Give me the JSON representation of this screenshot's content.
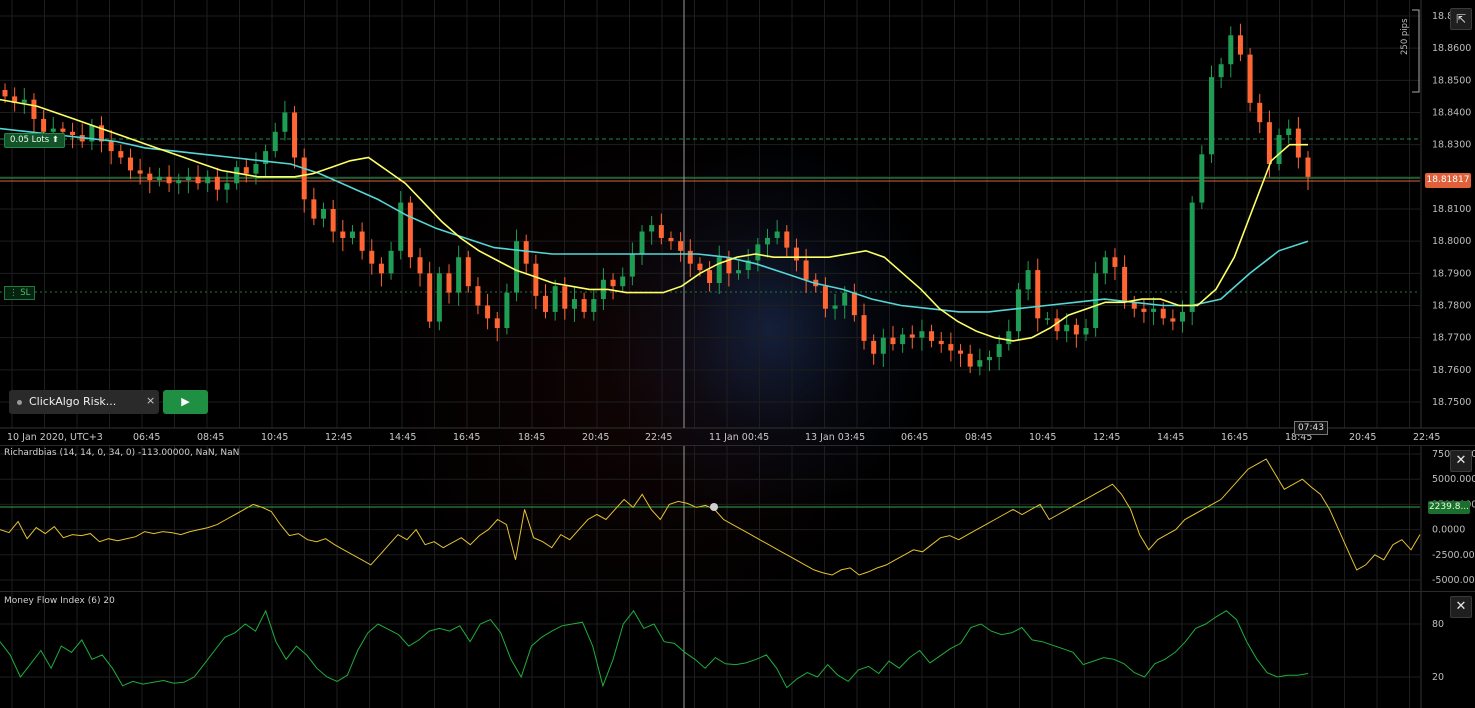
{
  "symbol_lot_label": "0.05 Lots ⬆",
  "sl_label": "⋮ SL",
  "bot": {
    "name": "ClickAlgo Risk...",
    "close": "×",
    "play": "▶"
  },
  "current_price": "18.81817",
  "time_badge": "07:43",
  "pips_label": "250 pips",
  "colors": {
    "bull": "#1f9d55",
    "bear": "#ff6633",
    "ma_fast": "#ffff66",
    "ma_slow": "#55d6d6",
    "rb_line": "#e6c230",
    "mfi_line": "#1fae3c",
    "grid": "#1e1e1e"
  },
  "icons": {
    "expand": "expand-icon",
    "close": "close-icon",
    "play": "play-icon"
  },
  "price_axis": [
    "18.8700",
    "18.8600",
    "18.8500",
    "18.8400",
    "18.8300",
    "18.8200",
    "18.8100",
    "18.8000",
    "18.7900",
    "18.7800",
    "18.7700",
    "18.7600",
    "18.7500"
  ],
  "time_axis": [
    "10 Jan 2020, UTC+3",
    "06:45",
    "08:45",
    "10:45",
    "12:45",
    "14:45",
    "16:45",
    "18:45",
    "20:45",
    "22:45",
    "11 Jan 00:45",
    "13 Jan 03:45",
    "06:45",
    "08:45",
    "10:45",
    "12:45",
    "14:45",
    "16:45",
    "18:45",
    "20:45",
    "22:45"
  ],
  "richardbias": {
    "title": "Richardbias (14, 14, 0, 34, 0) -113.00000, NaN, NaN",
    "axis": [
      "7500.0000",
      "5000.0000",
      "2500.0000",
      "0.0000",
      "-2500.0000",
      "-5000.0000"
    ],
    "level_badge": "2239.8..."
  },
  "mfi": {
    "title": "Money Flow Index (6) 20",
    "axis": [
      "80",
      "20"
    ]
  },
  "close_label": "✕",
  "expand_label": "⇱",
  "chart_data": {
    "type": "line",
    "candles_close": [
      18.845,
      18.843,
      18.844,
      18.838,
      18.834,
      18.835,
      18.834,
      18.833,
      18.831,
      18.836,
      18.831,
      18.828,
      18.826,
      18.822,
      18.821,
      18.819,
      18.82,
      18.818,
      18.819,
      18.82,
      18.818,
      18.82,
      18.816,
      18.818,
      18.823,
      18.821,
      18.824,
      18.828,
      18.834,
      18.84,
      18.826,
      18.813,
      18.807,
      18.81,
      18.803,
      18.801,
      18.803,
      18.797,
      18.793,
      18.79,
      18.797,
      18.812,
      18.795,
      18.79,
      18.775,
      18.79,
      18.784,
      18.795,
      18.786,
      18.78,
      18.776,
      18.773,
      18.784,
      18.8,
      18.793,
      18.783,
      18.778,
      18.786,
      18.779,
      18.782,
      18.778,
      18.782,
      18.788,
      18.786,
      18.789,
      18.796,
      18.803,
      18.805,
      18.801,
      18.8,
      18.797,
      18.793,
      18.791,
      18.787,
      18.795,
      18.79,
      18.791,
      18.794,
      18.799,
      18.801,
      18.803,
      18.798,
      18.794,
      18.788,
      18.786,
      18.779,
      18.78,
      18.784,
      18.777,
      18.769,
      18.765,
      18.77,
      18.768,
      18.771,
      18.77,
      18.772,
      18.769,
      18.768,
      18.766,
      18.765,
      18.761,
      18.763,
      18.764,
      18.768,
      18.772,
      18.785,
      18.791,
      18.776,
      18.776,
      18.772,
      18.774,
      18.771,
      18.773,
      18.79,
      18.795,
      18.792,
      18.781,
      18.779,
      18.778,
      18.779,
      18.776,
      18.775,
      18.778,
      18.812,
      18.827,
      18.851,
      18.855,
      18.864,
      18.858,
      18.843,
      18.837,
      18.824,
      18.833,
      18.835,
      18.826,
      18.82
    ],
    "ma_fast": [
      18.844,
      18.843,
      18.842,
      18.84,
      18.838,
      18.836,
      18.834,
      18.832,
      18.83,
      18.828,
      18.826,
      18.824,
      18.822,
      18.821,
      18.82,
      18.82,
      18.82,
      18.821,
      18.823,
      18.825,
      18.826,
      18.822,
      18.818,
      18.812,
      18.806,
      18.801,
      18.797,
      18.794,
      18.791,
      18.789,
      18.787,
      18.786,
      18.785,
      18.785,
      18.784,
      18.784,
      18.784,
      18.786,
      18.79,
      18.793,
      18.795,
      18.796,
      18.795,
      18.795,
      18.795,
      18.795,
      18.796,
      18.797,
      18.795,
      18.79,
      18.785,
      18.779,
      18.775,
      18.772,
      18.77,
      18.769,
      18.77,
      18.773,
      18.777,
      18.779,
      18.781,
      18.781,
      18.782,
      18.782,
      18.78,
      18.78,
      18.785,
      18.795,
      18.81,
      18.825,
      18.83,
      18.83
    ],
    "ma_slow": [
      18.835,
      18.834,
      18.833,
      18.832,
      18.831,
      18.829,
      18.828,
      18.827,
      18.826,
      18.825,
      18.824,
      18.821,
      18.817,
      18.813,
      18.808,
      18.804,
      18.801,
      18.798,
      18.797,
      18.796,
      18.796,
      18.796,
      18.796,
      18.796,
      18.796,
      18.795,
      18.793,
      18.79,
      18.787,
      18.785,
      18.782,
      18.78,
      18.779,
      18.778,
      18.778,
      18.779,
      18.78,
      18.781,
      18.782,
      18.781,
      18.78,
      18.78,
      18.782,
      18.79,
      18.797,
      18.8
    ],
    "richardbias_values": [
      0,
      -300,
      800,
      -900,
      200,
      -400,
      300,
      -800,
      -500,
      -600,
      -400,
      -1200,
      -900,
      -1100,
      -900,
      -700,
      -200,
      -400,
      -200,
      -300,
      -500,
      -200,
      0,
      200,
      500,
      1000,
      1500,
      2000,
      2500,
      2200,
      1800,
      500,
      -600,
      -400,
      -1000,
      -1200,
      -900,
      -1500,
      -2000,
      -2500,
      -3000,
      -3500,
      -2500,
      -1500,
      -500,
      -1000,
      0,
      -1500,
      -1200,
      -1800,
      -1300,
      -800,
      -1500,
      -600,
      0,
      1000,
      500,
      -3000,
      2000,
      -800,
      -1200,
      -1800,
      -500,
      -1000,
      0,
      1000,
      1500,
      1000,
      2000,
      3000,
      2200,
      3500,
      2000,
      1000,
      2500,
      2800,
      2600,
      2200,
      2400,
      2000,
      1000,
      500,
      0,
      -500,
      -1000,
      -1500,
      -2000,
      -2500,
      -3000,
      -3500,
      -4000,
      -4300,
      -4500,
      -4000,
      -3800,
      -4500,
      -4200,
      -3800,
      -3500,
      -3000,
      -2500,
      -2000,
      -2200,
      -1500,
      -800,
      -600,
      -1000,
      -500,
      0,
      500,
      1000,
      1500,
      2000,
      1500,
      2000,
      2500,
      1000,
      1500,
      2000,
      2500,
      3000,
      3500,
      4000,
      4500,
      3500,
      2000,
      -500,
      -2000,
      -1000,
      -500,
      0,
      1000,
      1500,
      2000,
      2500,
      3000,
      4000,
      5000,
      6000,
      6500,
      7000,
      5500,
      4000,
      4500,
      5000,
      4200,
      3500,
      2000,
      0,
      -2000,
      -4000,
      -3500,
      -2500,
      -3000,
      -1500,
      -1000,
      -2000,
      -500
    ],
    "mfi_values": [
      60,
      45,
      20,
      35,
      50,
      30,
      55,
      48,
      62,
      40,
      45,
      30,
      10,
      15,
      12,
      14,
      16,
      13,
      14,
      20,
      35,
      50,
      65,
      70,
      80,
      72,
      95,
      60,
      40,
      55,
      45,
      30,
      20,
      15,
      22,
      50,
      70,
      80,
      74,
      68,
      55,
      62,
      72,
      75,
      72,
      78,
      60,
      80,
      85,
      70,
      40,
      20,
      55,
      65,
      72,
      78,
      80,
      82,
      55,
      10,
      40,
      80,
      95,
      75,
      80,
      60,
      58,
      48,
      40,
      30,
      42,
      35,
      34,
      36,
      40,
      45,
      30,
      8,
      18,
      25,
      20,
      34,
      22,
      15,
      28,
      32,
      24,
      38,
      30,
      42,
      50,
      36,
      44,
      52,
      58,
      76,
      80,
      72,
      68,
      70,
      76,
      62,
      60,
      56,
      52,
      48,
      34,
      38,
      42,
      40,
      35,
      25,
      20,
      35,
      40,
      48,
      60,
      75,
      80,
      88,
      95,
      85,
      60,
      40,
      25,
      20,
      22,
      22,
      24
    ]
  }
}
